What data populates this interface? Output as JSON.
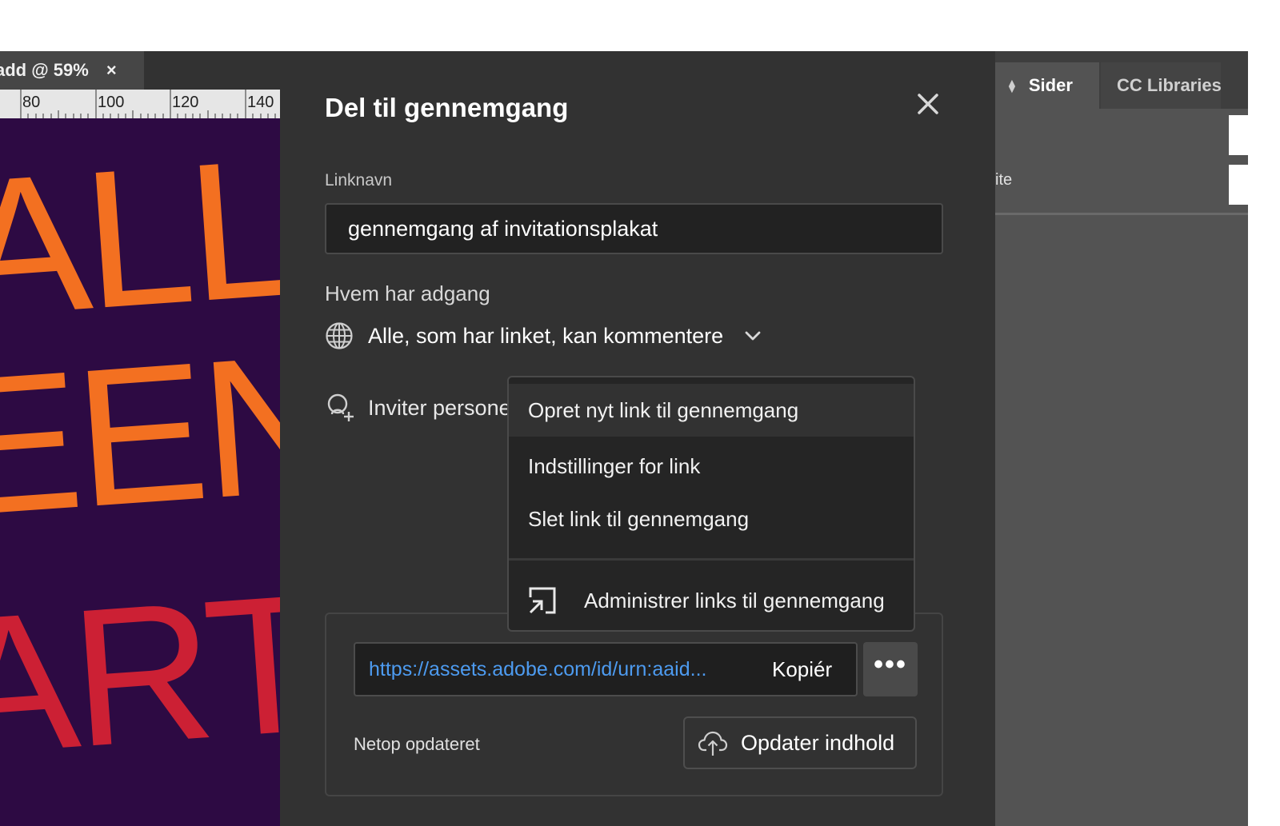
{
  "document": {
    "tab_title": "add @ 59%",
    "tab_close": "×",
    "ruler_labels": [
      "80",
      "100",
      "120",
      "140"
    ],
    "poster_lines": [
      "ALLO",
      "EEN",
      "ARTY"
    ]
  },
  "right_panel": {
    "tab_sider": "Sider",
    "tab_cc_libraries": "CC Libraries",
    "partial_text": "ite"
  },
  "dialog": {
    "title": "Del til gennemgang",
    "link_name_label": "Linknavn",
    "link_name_value": "gennemgang af invitationsplakat",
    "access_label": "Hvem har adgang",
    "access_value": "Alle, som har linket, kan kommentere",
    "invite_label": "Inviter personer",
    "url": "https://assets.adobe.com/id/urn:aaid...",
    "copy_label": "Kopiér",
    "more_label": "•••",
    "status_text": "Netop opdateret",
    "update_button_label": "Opdater indhold"
  },
  "menu": {
    "items": [
      "Opret nyt link til gennemgang",
      "Indstillinger for link",
      "Slet link til gennemgang",
      "Administrer links til gennemgang"
    ]
  },
  "colors": {
    "dialog_bg": "#323232",
    "link_blue": "#4d9bf0",
    "poster_bg": "#2d0a43",
    "poster_orange": "#f37021",
    "poster_red": "#cc2034"
  }
}
